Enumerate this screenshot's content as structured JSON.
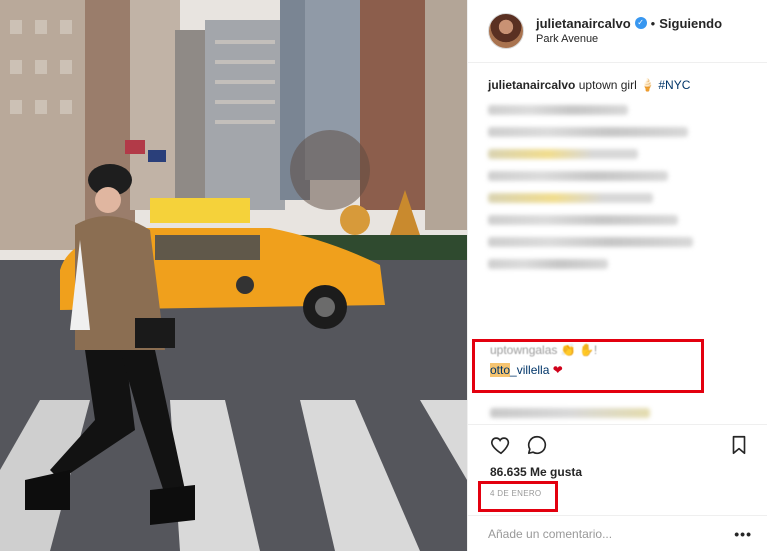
{
  "header": {
    "username": "julietanaircalvo",
    "separator": "•",
    "follow_status": "Siguiendo",
    "location": "Park Avenue"
  },
  "caption": {
    "username": "julietanaircalvo",
    "text": "uptown girl 🍦",
    "hashtag": "#NYC"
  },
  "comments": [
    {
      "text": "uptowngalas 👏 ✋!"
    },
    {
      "mention": "otto",
      "username_rest": "_villella",
      "text": "❤"
    }
  ],
  "actions": {
    "like_icon": "heart-icon",
    "comment_icon": "comment-bubble-icon",
    "save_icon": "bookmark-icon"
  },
  "likes": "86.635 Me gusta",
  "date": "4 DE ENERO",
  "comment_box": {
    "placeholder": "Añade un comentario...",
    "more_label": "•••"
  },
  "colors": {
    "highlight_border": "#e3000f",
    "mention_highlight": "#f6c470",
    "verified": "#3897f0"
  }
}
